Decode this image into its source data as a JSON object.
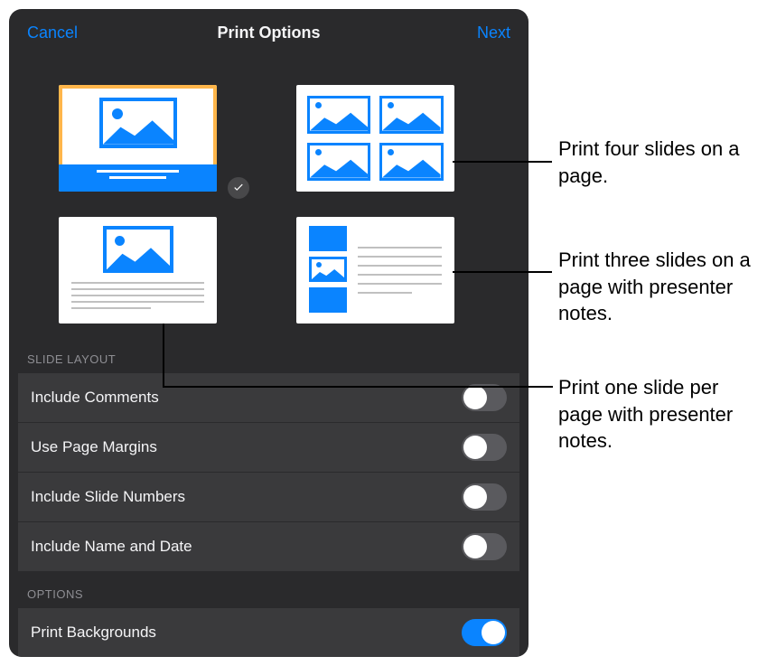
{
  "header": {
    "cancel": "Cancel",
    "title": "Print Options",
    "next": "Next"
  },
  "sections": {
    "slide_layout_header": "Slide Layout",
    "options_header": "Options"
  },
  "slide_layout_options": [
    {
      "label": "Include Comments",
      "on": false
    },
    {
      "label": "Use Page Margins",
      "on": false
    },
    {
      "label": "Include Slide Numbers",
      "on": false
    },
    {
      "label": "Include Name and Date",
      "on": false
    }
  ],
  "options": [
    {
      "label": "Print Backgrounds",
      "on": true
    }
  ],
  "callouts": {
    "four": "Print four slides on a page.",
    "three": "Print three slides on a page with presenter notes.",
    "one": "Print one slide per page with presenter notes."
  },
  "colors": {
    "accent": "#0a84ff"
  }
}
